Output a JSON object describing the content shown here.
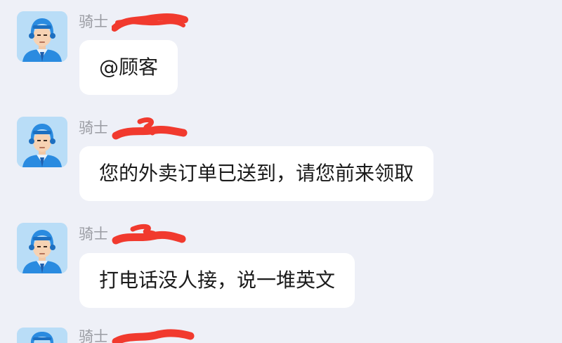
{
  "messages": [
    {
      "sender": "骑士",
      "text": "@顾客"
    },
    {
      "sender": "骑士",
      "text": "您的外卖订单已送到，请您前来领取"
    },
    {
      "sender": "骑士",
      "text": "打电话没人接，说一堆英文"
    },
    {
      "sender": "骑士"
    }
  ],
  "icons": {
    "avatar": "courier-helmet-avatar",
    "redaction": "red-scribble"
  },
  "colors": {
    "background": "#eef0f7",
    "bubble": "#ffffff",
    "sender_text": "#9a9ca3",
    "message_text": "#1b1b1b",
    "redaction": "#f13a2e",
    "avatar_bg": "#b9ddf7",
    "helmet": "#2a8be0"
  }
}
